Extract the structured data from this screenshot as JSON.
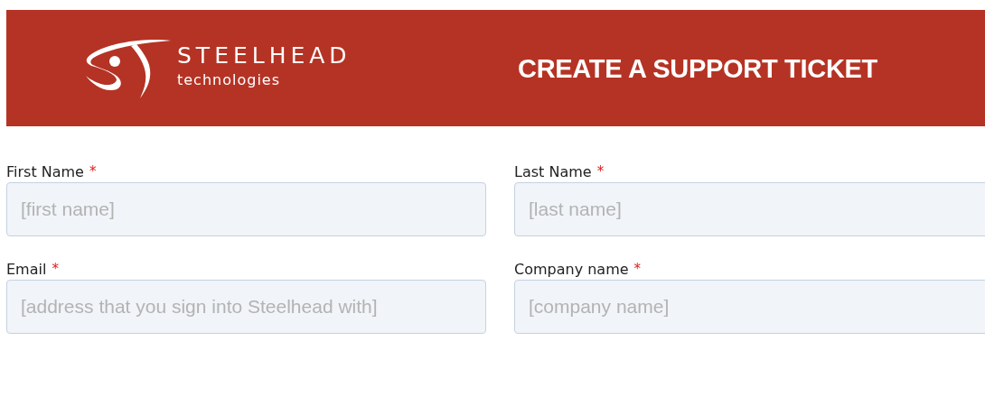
{
  "header": {
    "brand": {
      "name": "STEELHEAD",
      "tagline": "technologies"
    },
    "title": "CREATE A SUPPORT TICKET"
  },
  "form": {
    "fields": [
      {
        "label": "First Name",
        "required_mark": "*",
        "placeholder": "[first name]"
      },
      {
        "label": "Last Name",
        "required_mark": "*",
        "placeholder": "[last name]"
      },
      {
        "label": "Email",
        "required_mark": "*",
        "placeholder": "[address that you sign into Steelhead with]"
      },
      {
        "label": "Company name",
        "required_mark": "*",
        "placeholder": "[company name]"
      }
    ]
  }
}
